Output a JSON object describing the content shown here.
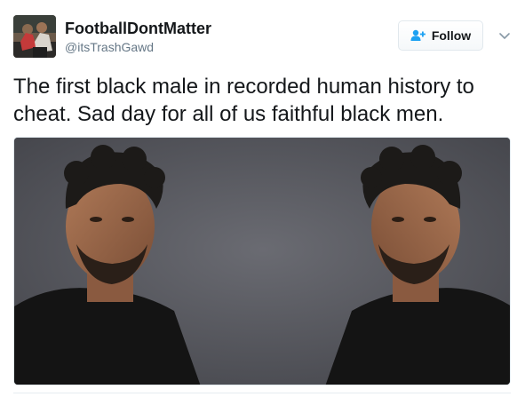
{
  "author": {
    "display_name": "FootballDontMatter",
    "handle": "@itsTrashGawd"
  },
  "follow_button": {
    "label": "Follow",
    "icon": "add-user-icon"
  },
  "menu": {
    "icon": "chevron-down-icon"
  },
  "tweet": {
    "text": "The first black male in recorded human history to cheat. Sad day for all of us faithful black men."
  },
  "colors": {
    "name": "#14171a",
    "handle": "#657786",
    "accent": "#1da1f2",
    "border": "#e1e8ed"
  }
}
